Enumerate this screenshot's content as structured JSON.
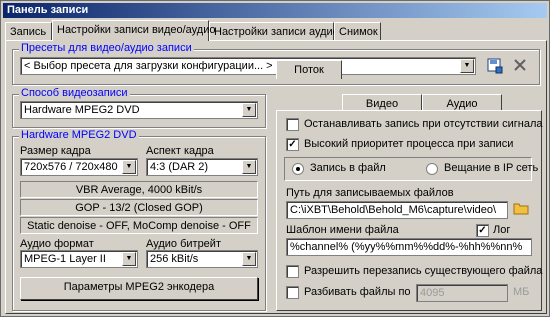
{
  "window": {
    "title": "Панель записи"
  },
  "tabs": [
    "Запись",
    "Настройки записи видео/аудио",
    "Настройки записи аудио",
    "Снимок"
  ],
  "presets": {
    "title": "Пресеты для видео/аудио записи",
    "value": "< Выбор пресета для загрузки конфигурации... >"
  },
  "method": {
    "title": "Способ видеозаписи",
    "value": "Hardware MPEG2 DVD"
  },
  "hw": {
    "title": "Hardware MPEG2 DVD",
    "frame_size_label": "Размер кадра",
    "frame_size_value": "720x576 / 720x480",
    "aspect_label": "Аспект кадра",
    "aspect_value": "4:3 (DAR 2)",
    "info1": "VBR Average, 4000 kBit/s",
    "info2": "GOP - 13/2 (Closed GOP)",
    "info3": "Static denoise - OFF, MoComp denoise - OFF",
    "audio_format_label": "Аудио формат",
    "audio_format_value": "MPEG-1 Layer II",
    "audio_bitrate_label": "Аудио битрейт",
    "audio_bitrate_value": "256 kBit/s",
    "encoder_button": "Параметры MPEG2 энкодера"
  },
  "right_tabs": [
    "Поток",
    "Видео",
    "Аудио"
  ],
  "stream": {
    "stop_no_signal": "Останавливать запись при отсутствии сигнала",
    "high_priority": "Высокий приоритет процесса при записи",
    "radio_file": "Запись в файл",
    "radio_ip": "Вещание в IP сеть",
    "path_label": "Путь для записываемых файлов",
    "path_value": "C:\\iXBT\\Behold\\Behold_M6\\capture\\video\\",
    "template_label": "Шаблон имени файла",
    "log_label": "Лог",
    "template_value": "%channel% (%yy%%mm%%dd%-%hh%%nn%",
    "allow_overwrite": "Разрешить перезапись существующего файла",
    "split_label": "Разбивать файлы по",
    "split_value": "4095",
    "split_unit": "МБ"
  }
}
